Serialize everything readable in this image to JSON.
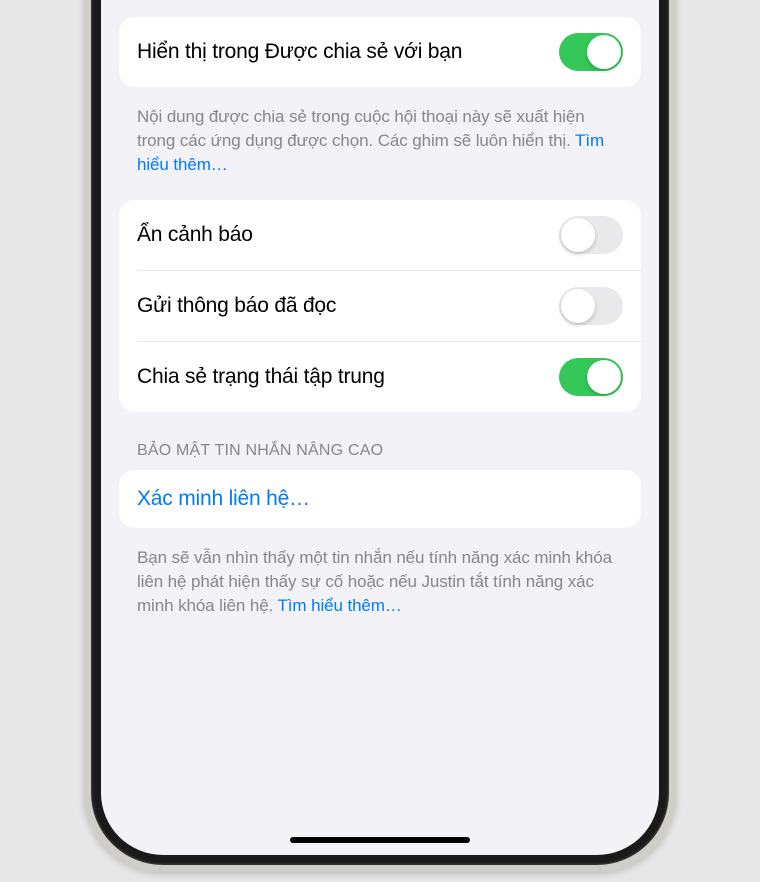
{
  "section1": {
    "show_in_shared": {
      "label": "Hiển thị trong Được chia sẻ với bạn",
      "enabled": true
    },
    "footer_text": "Nội dung được chia sẻ trong cuộc hội thoại này sẽ xuất hiện trong các ứng dụng được chọn. Các ghim sẽ luôn hiển thị. ",
    "footer_link": "Tìm hiểu thêm…"
  },
  "section2": {
    "hide_alerts": {
      "label": "Ẩn cảnh báo",
      "enabled": false
    },
    "read_receipts": {
      "label": "Gửi thông báo đã đọc",
      "enabled": false
    },
    "share_focus": {
      "label": "Chia sẻ trạng thái tập trung",
      "enabled": true
    }
  },
  "section3": {
    "header": "BẢO MẬT TIN NHẮN NÂNG CAO",
    "verify_contact": "Xác minh liên hệ…",
    "footer_text": "Bạn sẽ vẫn nhìn thấy một tin nhắn nếu tính năng xác minh khóa liên hệ phát hiện thấy sự cố hoặc nếu Justin tắt tính năng xác minh khóa liên hệ. ",
    "footer_link": "Tìm hiểu thêm…"
  }
}
